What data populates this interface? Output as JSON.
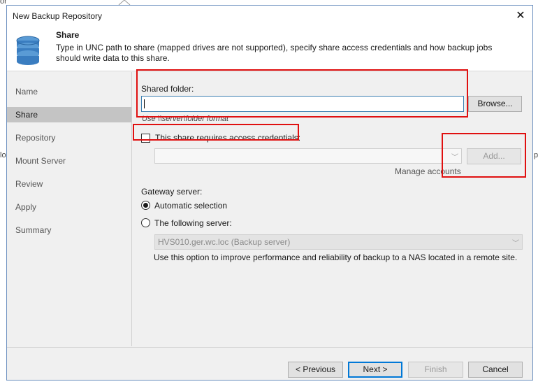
{
  "background": {
    "fragment_top": "or",
    "fragment_left": "lo",
    "fragment_right": "p"
  },
  "window": {
    "title": "New Backup Repository",
    "close_glyph": "✕"
  },
  "header": {
    "icon": "database-icon",
    "title": "Share",
    "description": "Type in UNC path to share (mapped drives are not supported), specify share access credentials and how backup jobs should write data to this share."
  },
  "sidebar": {
    "items": [
      {
        "label": "Name"
      },
      {
        "label": "Share"
      },
      {
        "label": "Repository"
      },
      {
        "label": "Mount Server"
      },
      {
        "label": "Review"
      },
      {
        "label": "Apply"
      },
      {
        "label": "Summary"
      }
    ],
    "active": "Share"
  },
  "share": {
    "folder_label": "Shared folder:",
    "folder_value": "",
    "browse_label": "Browse...",
    "format_hint": "Use \\\\server\\folder format",
    "credentials_label": "This share requires access credentials:",
    "credentials_checked": false,
    "credentials_value": "",
    "add_label": "Add...",
    "manage_accounts_label": "Manage accounts"
  },
  "gateway": {
    "label": "Gateway server:",
    "option_auto": "Automatic selection",
    "option_following": "The following server:",
    "selected": "Automatic selection",
    "server_value": "HVS010.ger.wc.loc (Backup server)",
    "note": "Use this option to improve performance and reliability of backup to a NAS located in a remote site."
  },
  "footer": {
    "previous_label": "< Previous",
    "next_label": "Next >",
    "finish_label": "Finish",
    "cancel_label": "Cancel"
  },
  "colors": {
    "highlight": "#e01010",
    "focus_blue": "#0078d7",
    "active_nav": "#c4c4c4"
  }
}
